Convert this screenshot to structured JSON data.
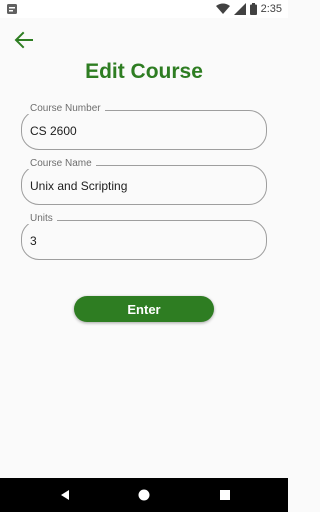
{
  "status_bar": {
    "time": "2:35",
    "icons": [
      "notification-icon",
      "wifi-icon",
      "signal-icon",
      "battery-icon"
    ]
  },
  "header": {
    "back_icon": "arrow-left-icon",
    "title": "Edit Course"
  },
  "form": {
    "course_number": {
      "label": "Course Number",
      "value": "CS 2600"
    },
    "course_name": {
      "label": "Course Name",
      "value": "Unix and Scripting"
    },
    "units": {
      "label": "Units",
      "value": "3"
    }
  },
  "actions": {
    "enter_label": "Enter"
  },
  "nav": [
    "back-triangle-icon",
    "home-circle-icon",
    "recents-square-icon"
  ],
  "colors": {
    "accent": "#2e7d22",
    "border": "#9e9e9e",
    "background": "#fafafa"
  }
}
